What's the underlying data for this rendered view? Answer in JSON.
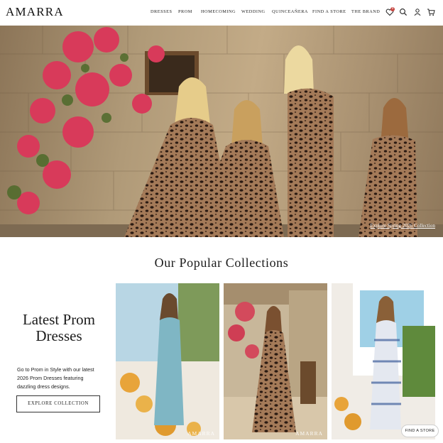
{
  "brand": {
    "logo_text": "AMARRA"
  },
  "nav": {
    "items": [
      {
        "label": "DRESSES"
      },
      {
        "label": "PROM"
      },
      {
        "label": "HOMECOMING"
      },
      {
        "label": "WEDDING"
      },
      {
        "label": "QUINCEAÑERA"
      },
      {
        "label": "FIND A STORE"
      },
      {
        "label": "THE BRAND"
      }
    ]
  },
  "header_icons": {
    "wishlist": {
      "icon": "heart-icon",
      "count": "0"
    },
    "search": {
      "icon": "search-icon"
    },
    "account": {
      "icon": "user-icon"
    },
    "cart": {
      "icon": "cart-icon"
    }
  },
  "hero": {
    "link_text": "Explore Spring 2026 Collection",
    "image": "four models in leopard-print gowns against a stone wall with pink bougainvillea"
  },
  "collections": {
    "title": "Our Popular Collections",
    "promo": {
      "heading": "Latest Prom Dresses",
      "body": "Go to Prom in Style with our latest 2026 Prom Dresses featuring dazzling dress designs.",
      "button_label": "EXPLORE COLLECTION"
    },
    "cards": [
      {
        "watermark": "AMARRA",
        "dress_color": "#7fb6c4"
      },
      {
        "watermark": "AMARRA",
        "dress_color": "#5a3f2e"
      },
      {
        "watermark": "",
        "dress_color": "#e4e8f0"
      }
    ]
  },
  "floating_button": {
    "label": "FIND A STORE"
  },
  "colors": {
    "accent": "#c6443f",
    "text": "#1b1b1b",
    "background": "#ffffff"
  }
}
